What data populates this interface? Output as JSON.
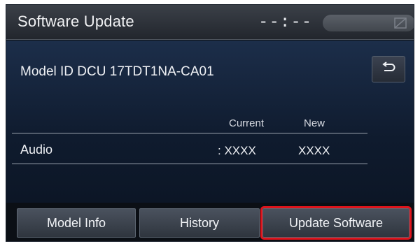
{
  "header": {
    "title": "Software Update",
    "clock": "--:--"
  },
  "model": {
    "label": "Model ID DCU  17TDT1NA-CA01"
  },
  "table": {
    "columns": {
      "current": "Current",
      "new": "New"
    },
    "rows": [
      {
        "label": "Audio",
        "current": ":  XXXX",
        "new": "XXXX"
      }
    ]
  },
  "tabs": [
    {
      "label": "Model Info"
    },
    {
      "label": "History"
    },
    {
      "label": "Update Software"
    }
  ],
  "icons": {
    "back": "back-arrow-icon",
    "signal": "no-signal-icon"
  },
  "colors": {
    "highlight": "#e0141c",
    "background": "#0e1219"
  }
}
